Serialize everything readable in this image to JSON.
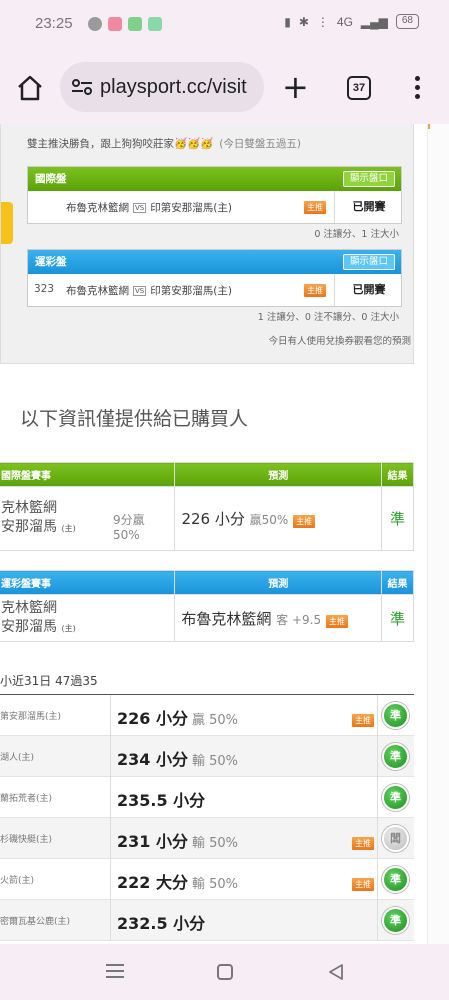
{
  "status": {
    "time": "23:25",
    "signal": "4G",
    "battery": "68",
    "icon_colors": [
      "#999999",
      "#f08aa0",
      "#7fd08a",
      "#88d8a8"
    ]
  },
  "browser": {
    "url": "playsport.cc/visit",
    "tab_count": "37"
  },
  "top_section": {
    "note": "雙主推決勝負，跟上狗狗咬莊家🥳🥳🥳",
    "note_extra": "(今日雙盤五過五)",
    "intl_panel": {
      "title": "國際盤",
      "show_button": "顯示盤口",
      "row": {
        "num": "",
        "home": "布魯克林籃網",
        "vs": "VS",
        "away": "印第安那溜馬(主)",
        "tag": "主推",
        "status": "已開賽"
      },
      "summary": "0 注讓分、1 注大小"
    },
    "lottery_panel": {
      "title": "運彩盤",
      "show_button": "顯示盤口",
      "row": {
        "num": "323",
        "home": "布魯克林籃網",
        "vs": "VS",
        "away": "印第安那溜馬(主)",
        "tag": "主推",
        "status": "已開賽"
      },
      "summary": "1 注讓分、0 注不讓分、0 注大小",
      "redeem_note": "今日有人使用兌換券觀看您的預測"
    }
  },
  "buyers_heading": "以下資訊僅提供給已購買人",
  "intl_table": {
    "headers": [
      "國際盤賽事",
      "預測",
      "結果"
    ],
    "team1": "克林籃網",
    "team2": "安那溜馬",
    "home_mark": "(主)",
    "win_line1": "9分贏",
    "win_line2": "50%",
    "prediction": "226 小分",
    "prediction_sub": "贏50%",
    "tag": "主推",
    "result": "準"
  },
  "lottery_table": {
    "headers": [
      "運彩盤賽事",
      "預測",
      "結果"
    ],
    "team1": "克林籃網",
    "team2": "安那溜馬",
    "home_mark": "(主)",
    "prediction": "布魯克林籃網",
    "prediction_sub": "客 +9.5",
    "tag": "主推",
    "result": "準"
  },
  "recent": {
    "label": "小近31日 47過35",
    "rows": [
      {
        "team": "第安那溜馬(主)",
        "pred": "226 小分",
        "sub": "贏 50%",
        "tag": "主推",
        "result": "準",
        "state": "win"
      },
      {
        "team": "湖人(主)",
        "pred": "234 小分",
        "sub": "輸 50%",
        "tag": "",
        "result": "準",
        "state": "win"
      },
      {
        "team": "蘭拓荒者(主)",
        "pred": "235.5 小分",
        "sub": "",
        "tag": "",
        "result": "準",
        "state": "win"
      },
      {
        "team": "杉磯快艇(主)",
        "pred": "231 小分",
        "sub": "輸 50%",
        "tag": "主推",
        "result": "闆",
        "state": "draw"
      },
      {
        "team": "火箭(主)",
        "pred": "222 大分",
        "sub": "輸 50%",
        "tag": "主推",
        "result": "準",
        "state": "win"
      },
      {
        "team": "密爾瓦基公鹿(主)",
        "pred": "232.5 小分",
        "sub": "",
        "tag": "",
        "result": "準",
        "state": "win"
      }
    ]
  }
}
